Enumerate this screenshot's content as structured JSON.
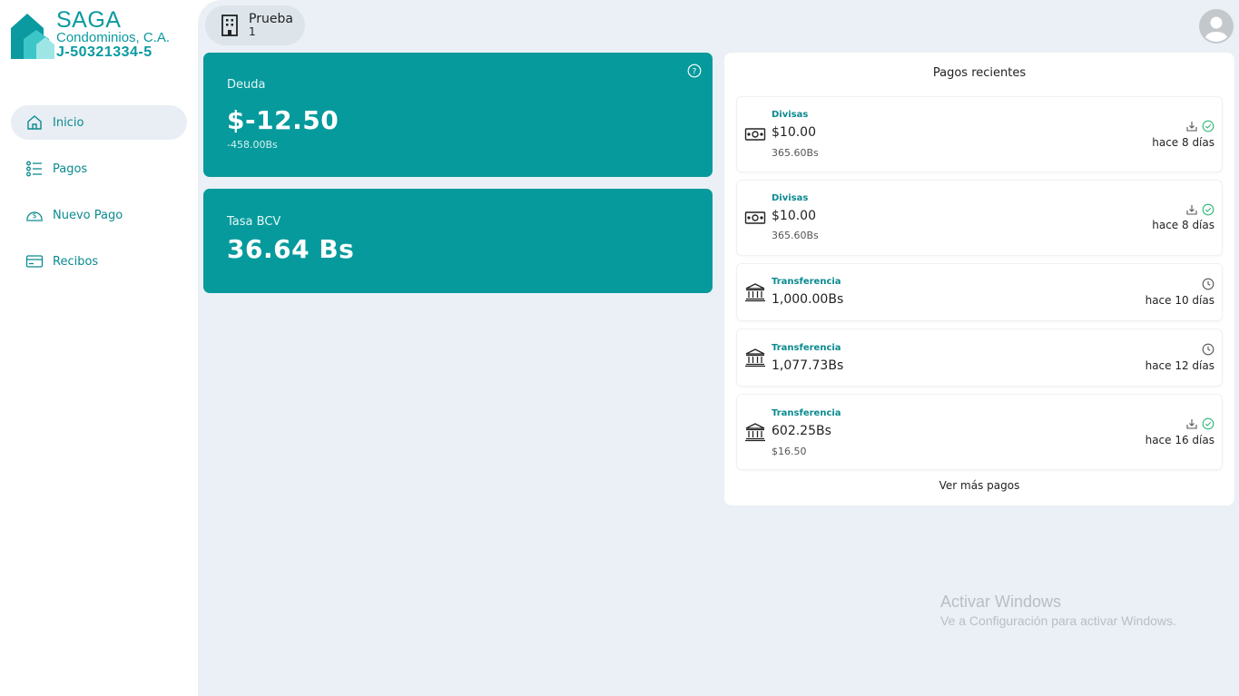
{
  "brand": {
    "name": "SAGA",
    "subtitle": "Condominios, C.A.",
    "rif": "J-50321334-5",
    "primary_color": "#069a9c",
    "accent_color": "#0a8a90"
  },
  "sidebar": {
    "items": [
      {
        "label": "Inicio",
        "icon": "home-icon",
        "active": true
      },
      {
        "label": "Pagos",
        "icon": "list-icon",
        "active": false
      },
      {
        "label": "Nuevo Pago",
        "icon": "money-circle-icon",
        "active": false
      },
      {
        "label": "Recibos",
        "icon": "card-icon",
        "active": false
      }
    ]
  },
  "header": {
    "unit_name": "Prueba",
    "unit_number": "1",
    "avatar_icon": "user-circle-icon"
  },
  "debt_card": {
    "label": "Deuda",
    "value": "$-12.50",
    "sub": "-458.00Bs",
    "help_icon": "question-circle-icon"
  },
  "rate_card": {
    "label": "Tasa BCV",
    "value": "36.64 Bs"
  },
  "recent_payments": {
    "title": "Pagos recientes",
    "more_label": "Ver más pagos",
    "items": [
      {
        "type": "Divisas",
        "amount": "$10.00",
        "sub": "365.60Bs",
        "time": "hace 8 días",
        "icon": "cash-icon",
        "status": "downloadable-approved"
      },
      {
        "type": "Divisas",
        "amount": "$10.00",
        "sub": "365.60Bs",
        "time": "hace 8 días",
        "icon": "cash-icon",
        "status": "downloadable-approved"
      },
      {
        "type": "Transferencia",
        "amount": "1,000.00Bs",
        "sub": "",
        "time": "hace 10 días",
        "icon": "bank-icon",
        "status": "pending"
      },
      {
        "type": "Transferencia",
        "amount": "1,077.73Bs",
        "sub": "",
        "time": "hace 12 días",
        "icon": "bank-icon",
        "status": "pending"
      },
      {
        "type": "Transferencia",
        "amount": "602.25Bs",
        "sub": "$16.50",
        "time": "hace 16 días",
        "icon": "bank-icon",
        "status": "downloadable-approved"
      }
    ]
  },
  "watermark": {
    "title": "Activar Windows",
    "sub": "Ve a Configuración para activar Windows."
  }
}
